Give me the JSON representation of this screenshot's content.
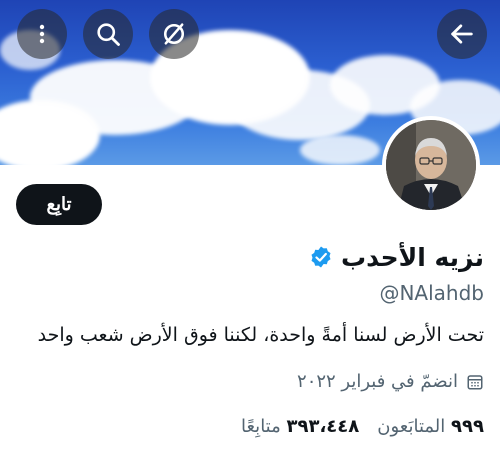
{
  "header": {
    "back_icon": "arrow-left-icon",
    "actions": [
      "kebab-menu-icon",
      "search-icon",
      "circle-slash-icon"
    ]
  },
  "profile": {
    "follow_label": "تابِع",
    "name": "نزيه الأحدب",
    "verified_icon": "verified-badge-icon",
    "handle": "@NAlahdb",
    "bio": "تحت الأرض لسنا أمةً واحدة، لكننا فوق الأرض شعب واحد",
    "joined": "انضمّ في فبراير ٢٠٢٢",
    "following_count": "٣٩٣،٤٤٨",
    "following_label": "متابِعًا",
    "followers_count": "٩٩٩",
    "followers_label": "المتابَعون"
  },
  "colors": {
    "accent": "#1d9bf0",
    "text": "#0f1419",
    "muted": "#536471"
  }
}
